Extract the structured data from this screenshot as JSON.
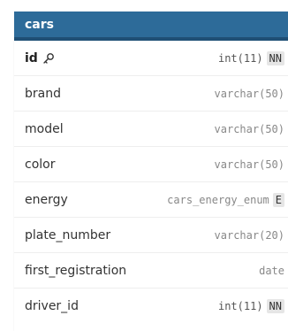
{
  "table": {
    "title": "cars",
    "colors": {
      "header": "#2d6b99",
      "header_border": "#1f4f75"
    },
    "columns": [
      {
        "name": "id",
        "type": "int(11)",
        "badge": "NN",
        "key_icon": "key-icon"
      },
      {
        "name": "brand",
        "type": "varchar(50)",
        "badge": ""
      },
      {
        "name": "model",
        "type": "varchar(50)",
        "badge": ""
      },
      {
        "name": "color",
        "type": "varchar(50)",
        "badge": ""
      },
      {
        "name": "energy",
        "type": "cars_energy_enum",
        "badge": "E"
      },
      {
        "name": "plate_number",
        "type": "varchar(20)",
        "badge": ""
      },
      {
        "name": "first_registration",
        "type": "date",
        "badge": ""
      },
      {
        "name": "driver_id",
        "type": "int(11)",
        "badge": "NN"
      }
    ]
  }
}
